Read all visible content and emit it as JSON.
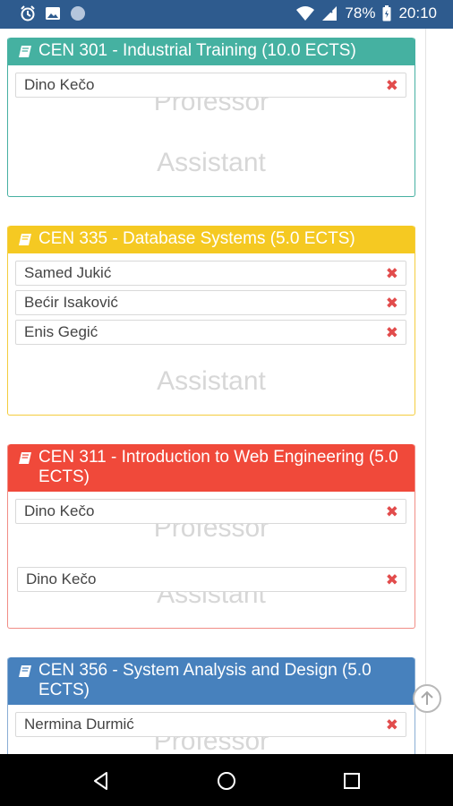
{
  "status_bar": {
    "icons_left": [
      "alarm-icon",
      "image-icon",
      "circle-icon"
    ],
    "battery_percent": "78%",
    "time": "20:10"
  },
  "courses": [
    {
      "title": "CEN 301 - Industrial Training (10.0 ECTS)",
      "color": "#45b1a1",
      "professors": [
        "Dino Kečo"
      ],
      "professor_label": "Professor",
      "assistants": [],
      "assistant_label": "Assistant"
    },
    {
      "title": "CEN 335 - Database Systems (5.0 ECTS)",
      "color": "#f5c922",
      "professors": [
        "Samed Jukić",
        "Bećir Isaković",
        "Enis Gegić"
      ],
      "assistants": [],
      "assistant_label": "Assistant"
    },
    {
      "title": "CEN 311 - Introduction to Web Engineering (5.0 ECTS)",
      "color": "#f0493a",
      "professors": [
        "Dino Kečo"
      ],
      "professor_label": "Professor",
      "assistants": [
        "Dino Kečo"
      ],
      "assistant_label": "Assistant"
    },
    {
      "title": "CEN 356 - System Analysis and Design (5.0 ECTS)",
      "color": "#4781bd",
      "professors": [
        "Nermina Durmić"
      ],
      "professor_label": "Professor"
    }
  ],
  "remove_symbol": "✖",
  "nav": {
    "buttons": [
      "back-icon",
      "home-icon",
      "recents-icon"
    ]
  }
}
